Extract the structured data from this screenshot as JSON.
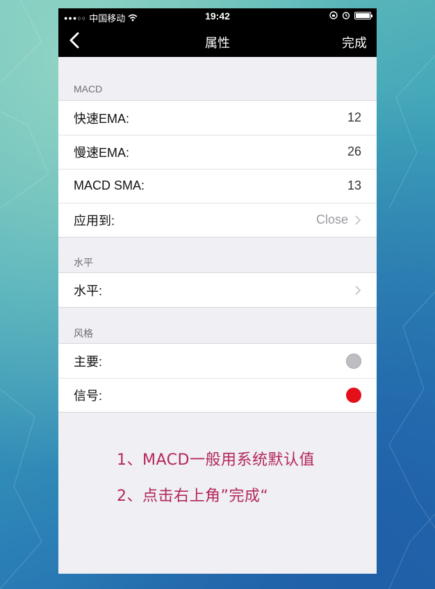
{
  "statusbar": {
    "carrier": "中国移动",
    "time": "19:42"
  },
  "navbar": {
    "title": "属性",
    "done": "完成"
  },
  "sections": {
    "macd": {
      "header": "MACD",
      "rows": [
        {
          "label": "快速EMA:",
          "value": "12"
        },
        {
          "label": "慢速EMA:",
          "value": "26"
        },
        {
          "label": "MACD SMA:",
          "value": "13"
        },
        {
          "label": "应用到:",
          "value": "Close"
        }
      ]
    },
    "level": {
      "header": "水平",
      "rows": [
        {
          "label": "水平:",
          "value": ""
        }
      ]
    },
    "style": {
      "header": "风格",
      "rows": [
        {
          "label": "主要:",
          "color": "#bdbdc2"
        },
        {
          "label": "信号:",
          "color": "#e3101a"
        }
      ]
    }
  },
  "notes": [
    "1、MACD一般用系统默认值",
    "2、点击右上角”完成“"
  ],
  "colors": {
    "note": "#b4265a",
    "navbar": "#000000",
    "background": "#efeff4"
  },
  "icons": {
    "back": "chevron-left-icon",
    "disclosure": "chevron-right-icon",
    "wifi": "wifi-icon",
    "battery": "battery-icon",
    "alarm": "alarm-icon",
    "rotation_lock": "rotation-lock-icon"
  }
}
